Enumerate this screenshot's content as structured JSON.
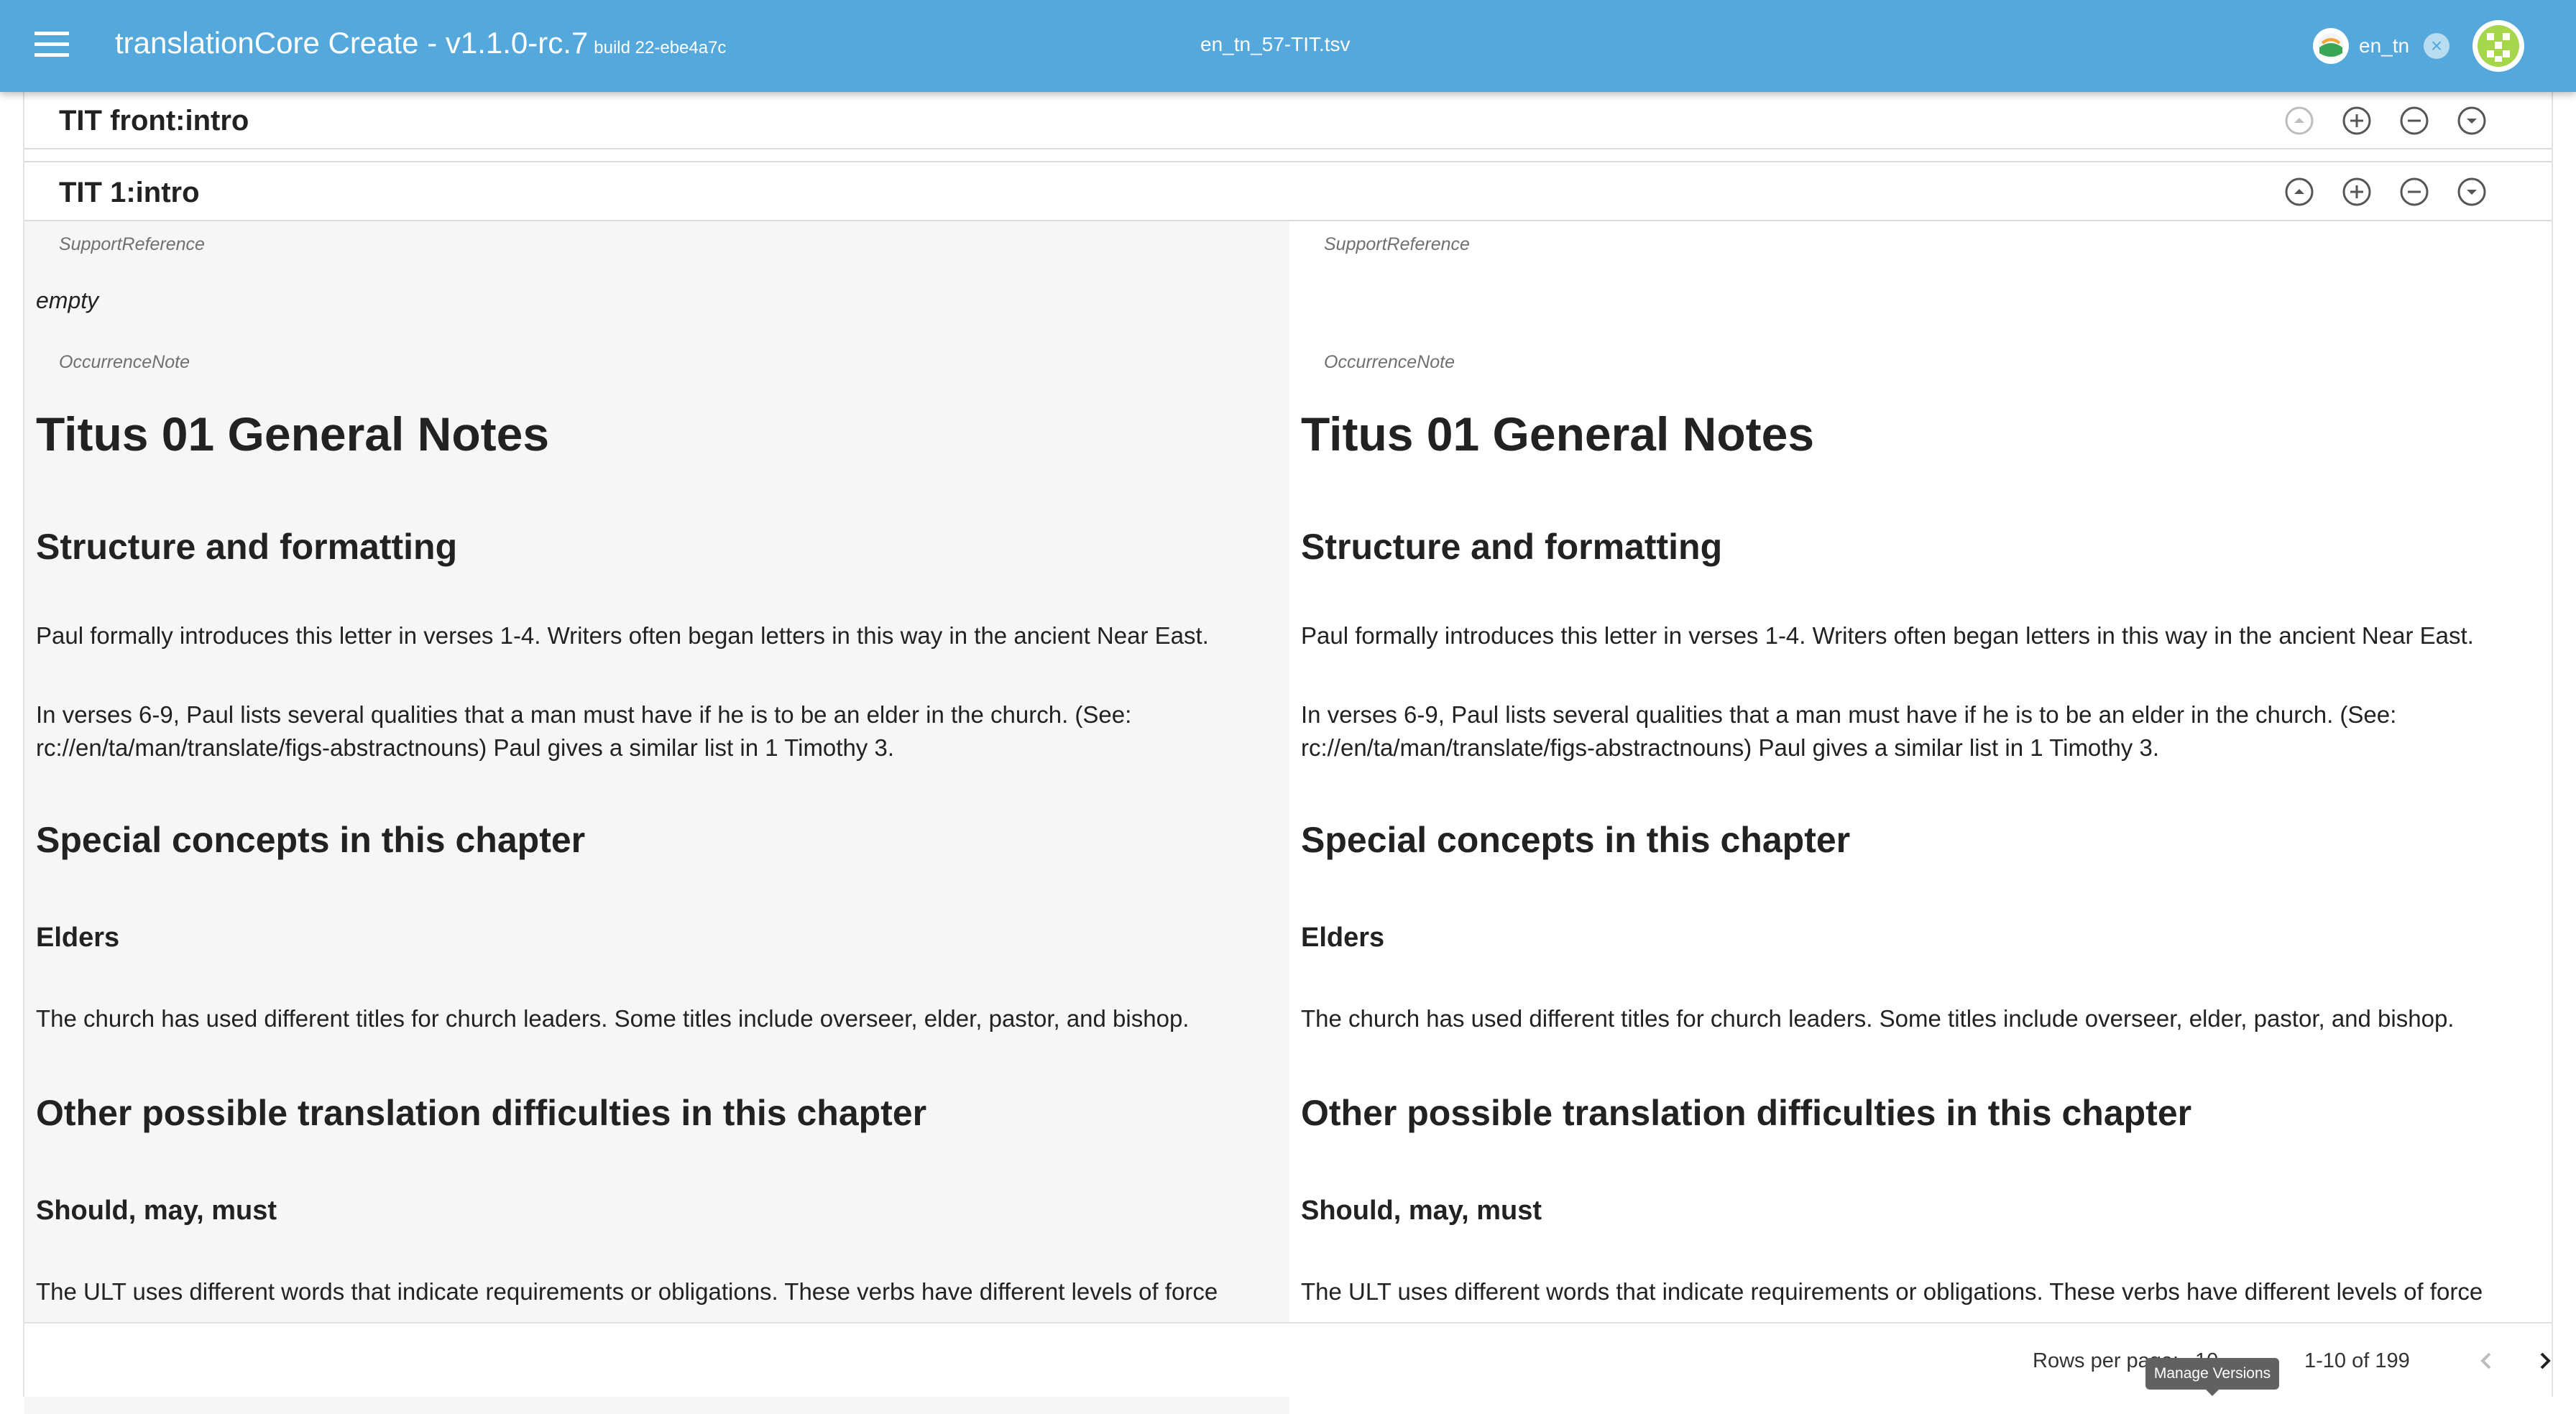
{
  "appbar": {
    "title": "translationCore Create - v1.1.0-rc.7",
    "build": "build 22-ebe4a7c",
    "file_name": "en_tn_57-TIT.tsv",
    "language_chip": "en_tn",
    "colors": {
      "bar": "#54a8dc"
    }
  },
  "rows": [
    {
      "reference": "TIT front:intro"
    },
    {
      "reference": "TIT 1:intro"
    }
  ],
  "fields": {
    "support_reference_label": "SupportReference",
    "occurrence_note_label": "OccurrenceNote"
  },
  "source_pane": {
    "support_reference_value": "empty",
    "note": {
      "h1": "Titus 01 General Notes",
      "h2_structure": "Structure and formatting",
      "p_intro": "Paul formally introduces this letter in verses 1-4. Writers often began letters in this way in the ancient Near East.",
      "p_elders_list": "In verses 6-9, Paul lists several qualities that a man must have if he is to be an elder in the church. (See: rc://en/ta/man/translate/figs-abstractnouns) Paul gives a similar list in 1 Timothy 3.",
      "h2_special": "Special concepts in this chapter",
      "h3_elders": "Elders",
      "p_church": "The church has used different titles for church leaders. Some titles include overseer, elder, pastor, and bishop.",
      "h2_other": "Other possible translation difficulties in this chapter",
      "h3_should": "Should, may, must",
      "p_ult": "The ULT uses different words that indicate requirements or obligations. These verbs have different levels of force"
    }
  },
  "target_pane": {
    "note": {
      "h1": "Titus 01 General Notes",
      "h2_structure": "Structure and formatting",
      "p_intro": "Paul formally introduces this letter in verses 1-4. Writers often began letters in this way in the ancient Near East.",
      "p_elders_list": "In verses 6-9, Paul lists several qualities that a man must have if he is to be an elder in the church. (See: rc://en/ta/man/translate/figs-abstractnouns) Paul gives a similar list in 1 Timothy 3.",
      "h2_special": "Special concepts in this chapter",
      "h3_elders": "Elders",
      "p_church": "The church has used different titles for church leaders. Some titles include overseer, elder, pastor, and bishop.",
      "h2_other": "Other possible translation difficulties in this chapter",
      "h3_should": "Should, may, must",
      "p_ult": "The ULT uses different words that indicate requirements or obligations. These verbs have different levels of force"
    }
  },
  "footer": {
    "rows_per_page_label": "Rows per page:",
    "rows_per_page_value": "10",
    "page_range": "1-10 of 199"
  },
  "tooltip": {
    "text": "Manage Versions"
  }
}
